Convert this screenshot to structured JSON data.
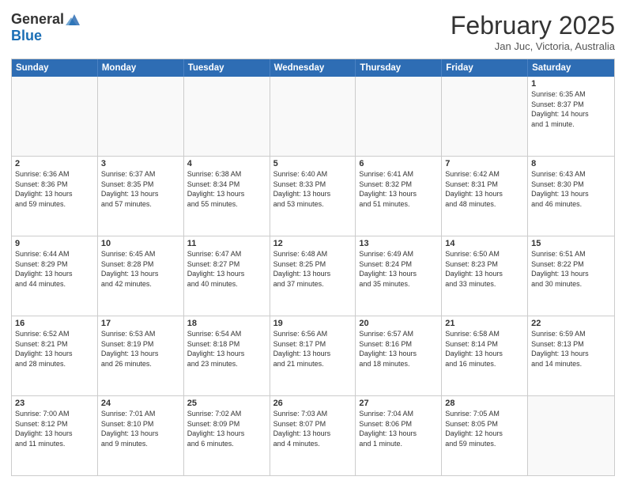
{
  "header": {
    "logo_general": "General",
    "logo_blue": "Blue",
    "month_year": "February 2025",
    "location": "Jan Juc, Victoria, Australia"
  },
  "days_of_week": [
    "Sunday",
    "Monday",
    "Tuesday",
    "Wednesday",
    "Thursday",
    "Friday",
    "Saturday"
  ],
  "weeks": [
    [
      {
        "day": "",
        "info": ""
      },
      {
        "day": "",
        "info": ""
      },
      {
        "day": "",
        "info": ""
      },
      {
        "day": "",
        "info": ""
      },
      {
        "day": "",
        "info": ""
      },
      {
        "day": "",
        "info": ""
      },
      {
        "day": "1",
        "info": "Sunrise: 6:35 AM\nSunset: 8:37 PM\nDaylight: 14 hours\nand 1 minute."
      }
    ],
    [
      {
        "day": "2",
        "info": "Sunrise: 6:36 AM\nSunset: 8:36 PM\nDaylight: 13 hours\nand 59 minutes."
      },
      {
        "day": "3",
        "info": "Sunrise: 6:37 AM\nSunset: 8:35 PM\nDaylight: 13 hours\nand 57 minutes."
      },
      {
        "day": "4",
        "info": "Sunrise: 6:38 AM\nSunset: 8:34 PM\nDaylight: 13 hours\nand 55 minutes."
      },
      {
        "day": "5",
        "info": "Sunrise: 6:40 AM\nSunset: 8:33 PM\nDaylight: 13 hours\nand 53 minutes."
      },
      {
        "day": "6",
        "info": "Sunrise: 6:41 AM\nSunset: 8:32 PM\nDaylight: 13 hours\nand 51 minutes."
      },
      {
        "day": "7",
        "info": "Sunrise: 6:42 AM\nSunset: 8:31 PM\nDaylight: 13 hours\nand 48 minutes."
      },
      {
        "day": "8",
        "info": "Sunrise: 6:43 AM\nSunset: 8:30 PM\nDaylight: 13 hours\nand 46 minutes."
      }
    ],
    [
      {
        "day": "9",
        "info": "Sunrise: 6:44 AM\nSunset: 8:29 PM\nDaylight: 13 hours\nand 44 minutes."
      },
      {
        "day": "10",
        "info": "Sunrise: 6:45 AM\nSunset: 8:28 PM\nDaylight: 13 hours\nand 42 minutes."
      },
      {
        "day": "11",
        "info": "Sunrise: 6:47 AM\nSunset: 8:27 PM\nDaylight: 13 hours\nand 40 minutes."
      },
      {
        "day": "12",
        "info": "Sunrise: 6:48 AM\nSunset: 8:25 PM\nDaylight: 13 hours\nand 37 minutes."
      },
      {
        "day": "13",
        "info": "Sunrise: 6:49 AM\nSunset: 8:24 PM\nDaylight: 13 hours\nand 35 minutes."
      },
      {
        "day": "14",
        "info": "Sunrise: 6:50 AM\nSunset: 8:23 PM\nDaylight: 13 hours\nand 33 minutes."
      },
      {
        "day": "15",
        "info": "Sunrise: 6:51 AM\nSunset: 8:22 PM\nDaylight: 13 hours\nand 30 minutes."
      }
    ],
    [
      {
        "day": "16",
        "info": "Sunrise: 6:52 AM\nSunset: 8:21 PM\nDaylight: 13 hours\nand 28 minutes."
      },
      {
        "day": "17",
        "info": "Sunrise: 6:53 AM\nSunset: 8:19 PM\nDaylight: 13 hours\nand 26 minutes."
      },
      {
        "day": "18",
        "info": "Sunrise: 6:54 AM\nSunset: 8:18 PM\nDaylight: 13 hours\nand 23 minutes."
      },
      {
        "day": "19",
        "info": "Sunrise: 6:56 AM\nSunset: 8:17 PM\nDaylight: 13 hours\nand 21 minutes."
      },
      {
        "day": "20",
        "info": "Sunrise: 6:57 AM\nSunset: 8:16 PM\nDaylight: 13 hours\nand 18 minutes."
      },
      {
        "day": "21",
        "info": "Sunrise: 6:58 AM\nSunset: 8:14 PM\nDaylight: 13 hours\nand 16 minutes."
      },
      {
        "day": "22",
        "info": "Sunrise: 6:59 AM\nSunset: 8:13 PM\nDaylight: 13 hours\nand 14 minutes."
      }
    ],
    [
      {
        "day": "23",
        "info": "Sunrise: 7:00 AM\nSunset: 8:12 PM\nDaylight: 13 hours\nand 11 minutes."
      },
      {
        "day": "24",
        "info": "Sunrise: 7:01 AM\nSunset: 8:10 PM\nDaylight: 13 hours\nand 9 minutes."
      },
      {
        "day": "25",
        "info": "Sunrise: 7:02 AM\nSunset: 8:09 PM\nDaylight: 13 hours\nand 6 minutes."
      },
      {
        "day": "26",
        "info": "Sunrise: 7:03 AM\nSunset: 8:07 PM\nDaylight: 13 hours\nand 4 minutes."
      },
      {
        "day": "27",
        "info": "Sunrise: 7:04 AM\nSunset: 8:06 PM\nDaylight: 13 hours\nand 1 minute."
      },
      {
        "day": "28",
        "info": "Sunrise: 7:05 AM\nSunset: 8:05 PM\nDaylight: 12 hours\nand 59 minutes."
      },
      {
        "day": "",
        "info": ""
      }
    ]
  ]
}
